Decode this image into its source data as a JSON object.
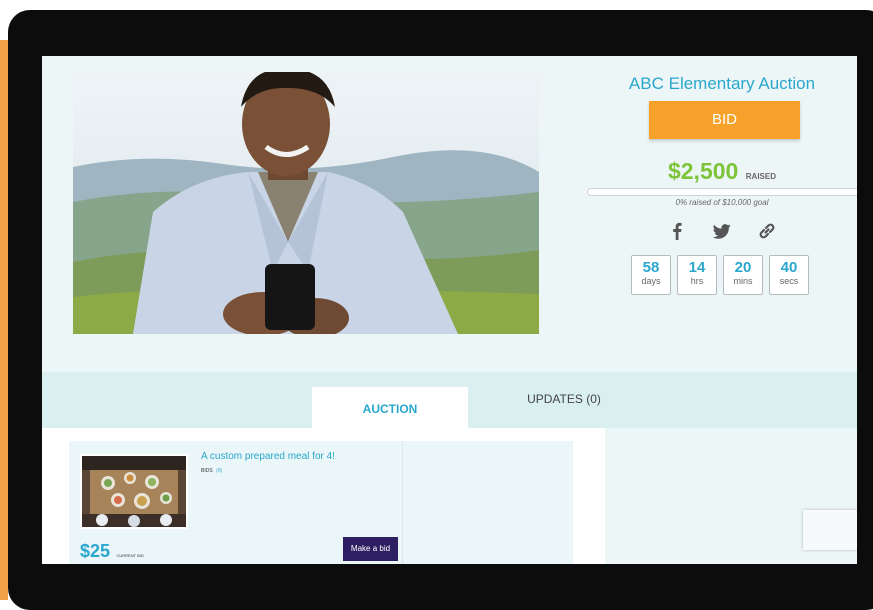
{
  "campaign": {
    "title": "ABC Elementary Auction",
    "bid_button_label": "BID",
    "raised_amount": "$2,500",
    "raised_label": "RAISED",
    "progress_percent": 0,
    "goal_text": "0% raised of $10,000 goal"
  },
  "share": {
    "icons": [
      "facebook-icon",
      "twitter-icon",
      "link-icon"
    ]
  },
  "countdown": [
    {
      "value": "58",
      "unit": "days"
    },
    {
      "value": "14",
      "unit": "hrs"
    },
    {
      "value": "20",
      "unit": "mins"
    },
    {
      "value": "40",
      "unit": "secs"
    }
  ],
  "tabs": {
    "auction": "AUCTION",
    "updates": "UPDATES (0)"
  },
  "item": {
    "title": "A custom prepared meal for 4!",
    "bids_label": "BIDS",
    "bids_count": "(0)",
    "current_bid": "$25",
    "current_bid_label": "CURRENT BID",
    "make_bid_label": "Make a bid"
  },
  "colors": {
    "accent": "#2aa7cc",
    "bid_button": "#f6a12a",
    "raised": "#7cc43a",
    "make_bid": "#2e1f63"
  }
}
